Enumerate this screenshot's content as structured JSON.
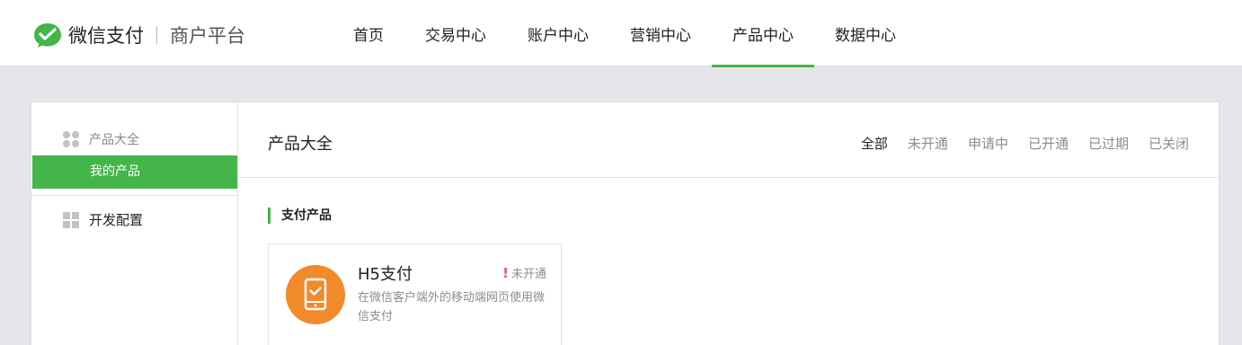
{
  "header": {
    "brand": "微信支付",
    "subtitle": "商户平台",
    "nav": [
      {
        "label": "首页"
      },
      {
        "label": "交易中心"
      },
      {
        "label": "账户中心"
      },
      {
        "label": "营销中心"
      },
      {
        "label": "产品中心",
        "active": true
      },
      {
        "label": "数据中心"
      }
    ]
  },
  "sidebar": {
    "group_label": "产品大全",
    "group_icon": "four-dots-icon",
    "active_item": "我的产品",
    "dev_label": "开发配置",
    "dev_icon": "grid-icon"
  },
  "content": {
    "title": "产品大全",
    "filters": [
      "全部",
      "未开通",
      "申请中",
      "已开通",
      "已过期",
      "已关闭"
    ],
    "active_filter": "全部",
    "section_title": "支付产品",
    "product": {
      "name": "H5支付",
      "status": "未开通",
      "description": "在微信客户端外的移动端网页使用微信支付",
      "icon": "mobile-check-icon"
    }
  },
  "colors": {
    "accent": "#44b549",
    "orange": "#f08a2b",
    "alert": "#e15f63"
  }
}
